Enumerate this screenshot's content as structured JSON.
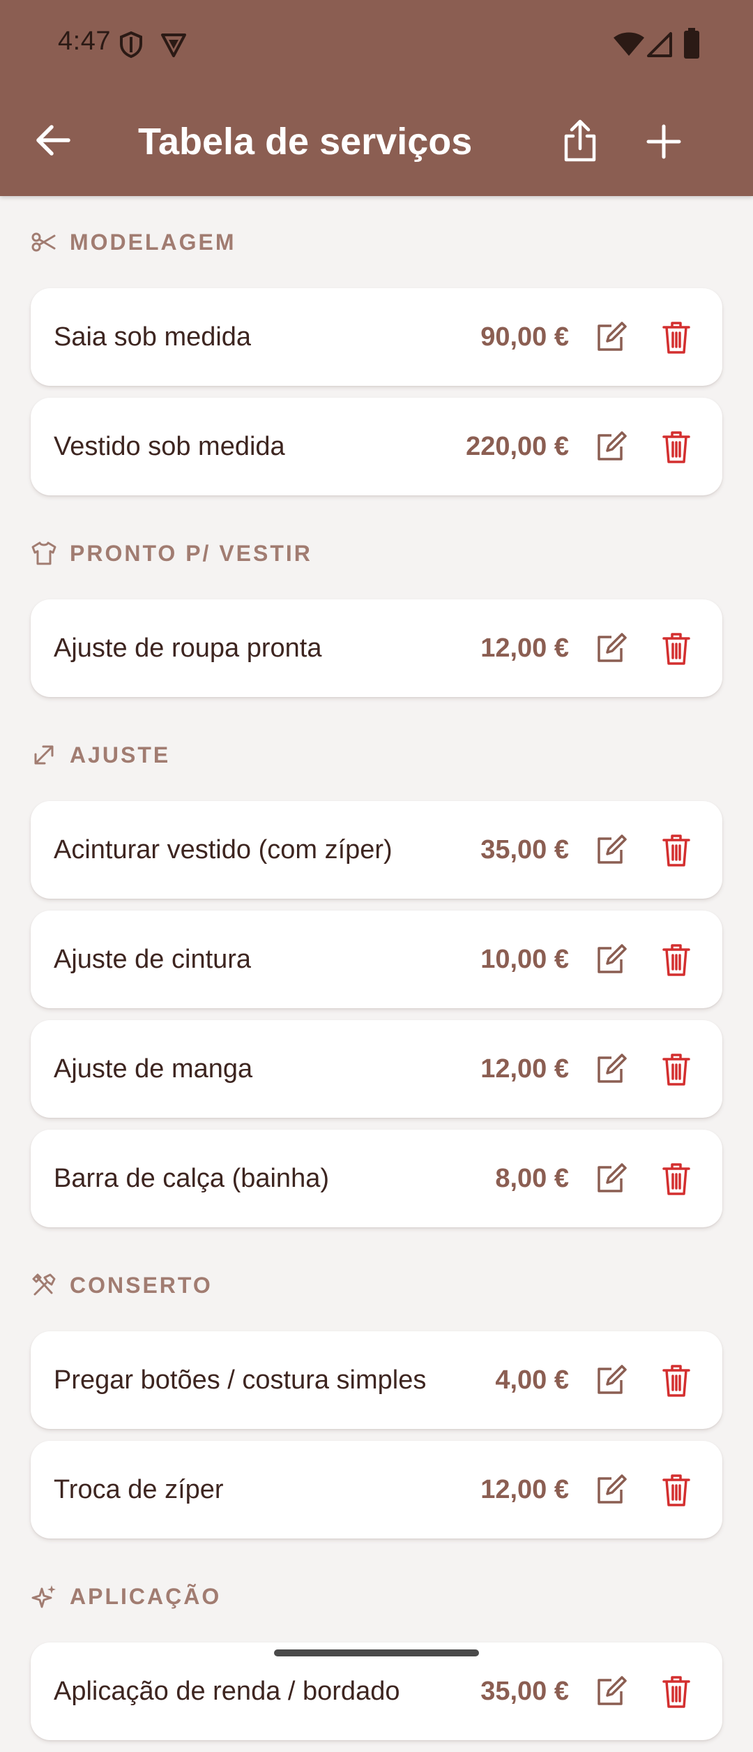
{
  "status_bar": {
    "time": "4:47"
  },
  "app_bar": {
    "title": "Tabela de serviços",
    "back_icon": "arrow-back-icon",
    "share_icon": "share-icon",
    "add_icon": "plus-icon"
  },
  "colors": {
    "app_bar": "#8b5e52",
    "background": "#f5f3f2",
    "section_title": "#a17c71",
    "price": "#8b5e52",
    "delete": "#d32f2f",
    "edit": "#8b5e52"
  },
  "sections": [
    {
      "title": "MODELAGEM",
      "icon": "scissors-icon",
      "items": [
        {
          "name": "Saia sob medida",
          "price": "90,00 €"
        },
        {
          "name": "Vestido sob medida",
          "price": "220,00 €"
        }
      ]
    },
    {
      "title": "PRONTO P/ VESTIR",
      "icon": "shirt-icon",
      "items": [
        {
          "name": "Ajuste de roupa pronta",
          "price": "12,00 €"
        }
      ]
    },
    {
      "title": "AJUSTE",
      "icon": "resize-arrows-icon",
      "items": [
        {
          "name": "Acinturar vestido (com zíper)",
          "price": "35,00 €"
        },
        {
          "name": "Ajuste de cintura",
          "price": "10,00 €"
        },
        {
          "name": "Ajuste de manga",
          "price": "12,00 €"
        },
        {
          "name": "Barra de calça (bainha)",
          "price": "8,00 €"
        }
      ]
    },
    {
      "title": "CONSERTO",
      "icon": "tools-icon",
      "items": [
        {
          "name": "Pregar botões / costura simples",
          "price": "4,00 €"
        },
        {
          "name": "Troca de zíper",
          "price": "12,00 €"
        }
      ]
    },
    {
      "title": "APLICAÇÃO",
      "icon": "sparkles-icon",
      "items": [
        {
          "name": "Aplicação de renda / bordado",
          "price": "35,00 €"
        }
      ]
    }
  ]
}
